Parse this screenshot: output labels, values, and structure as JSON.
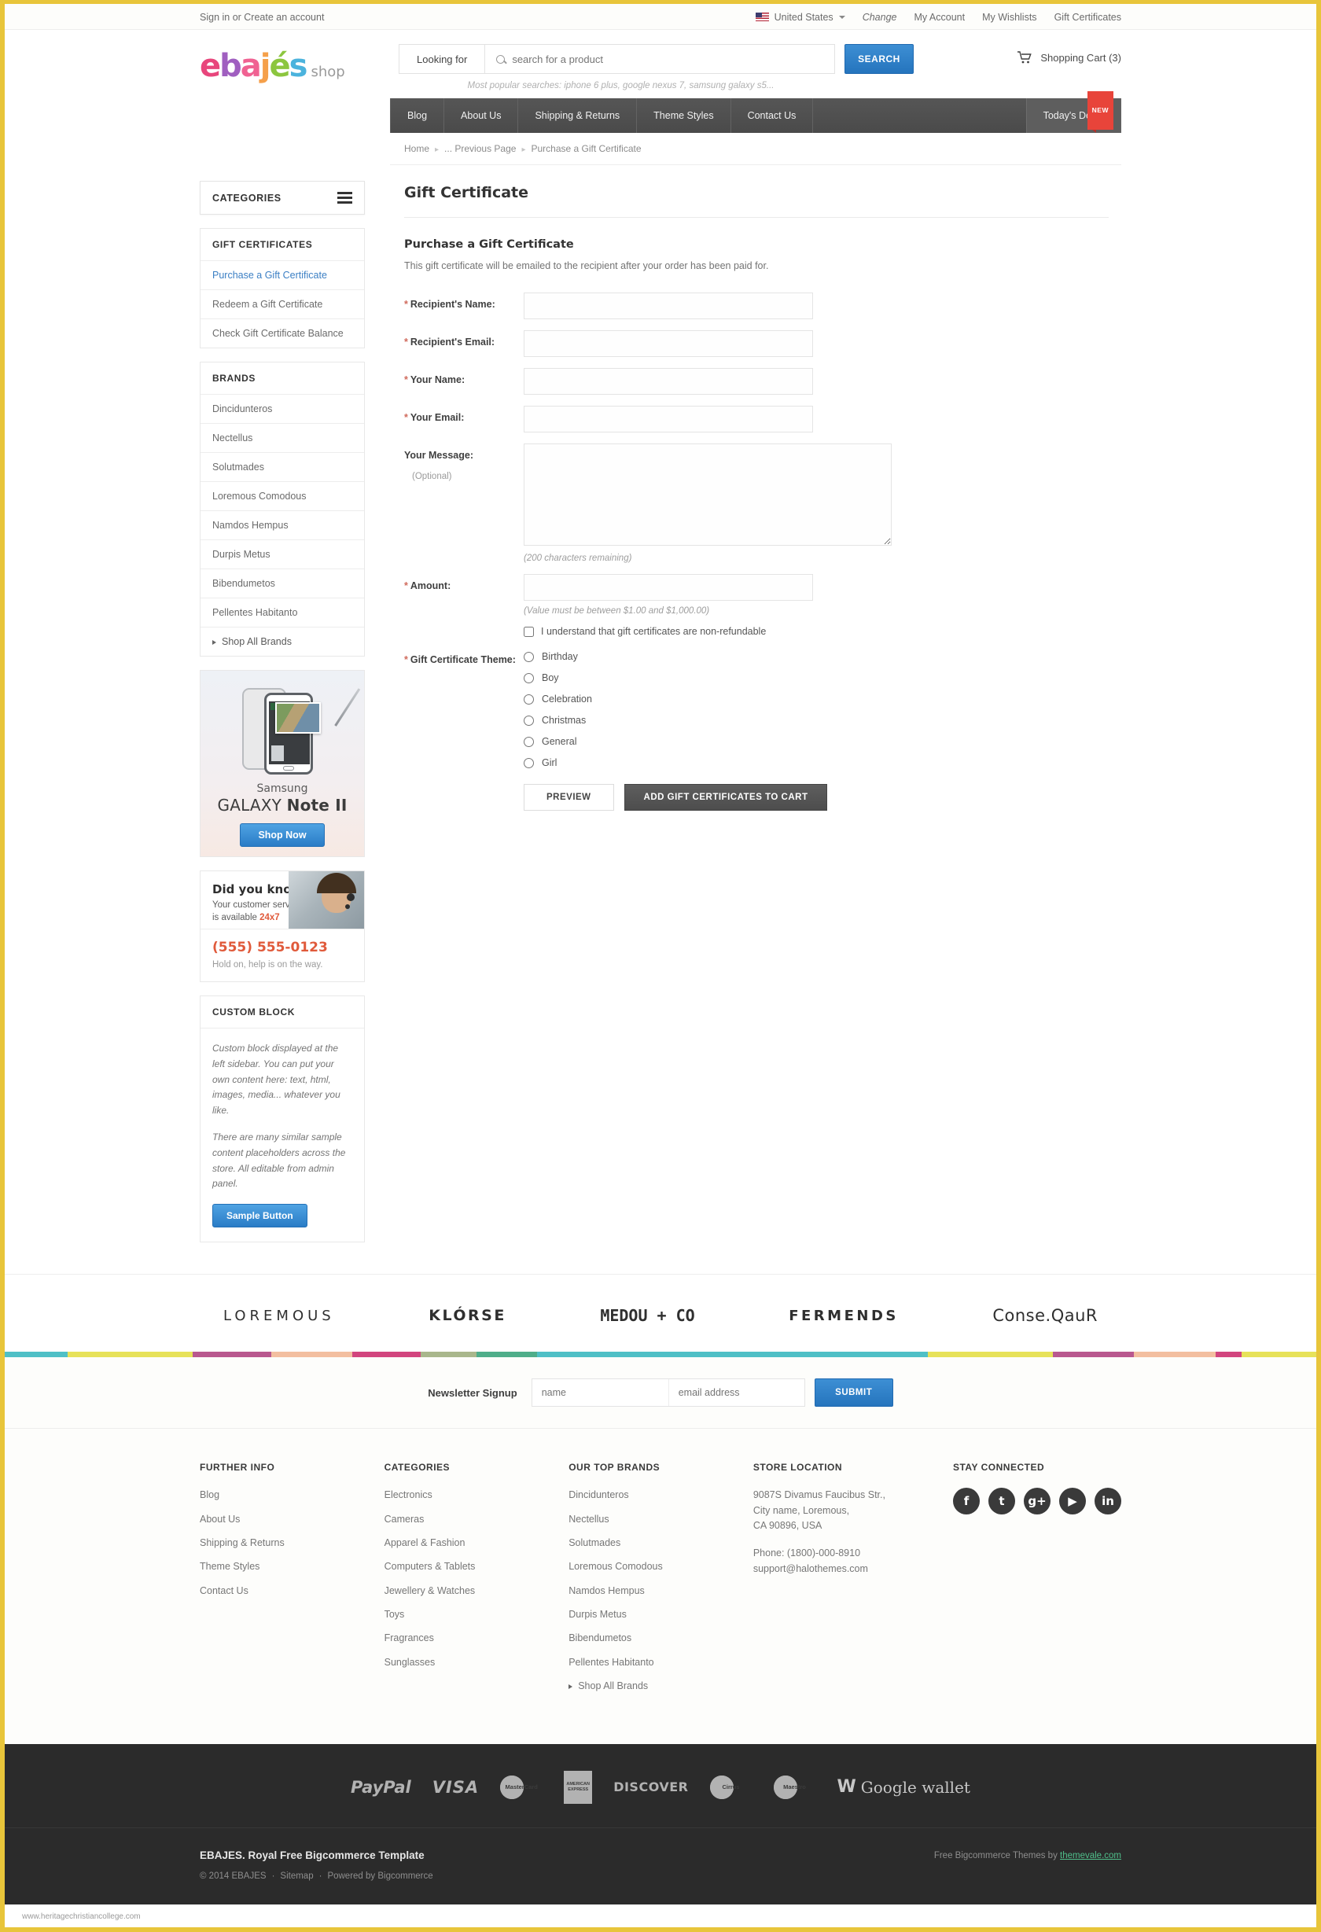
{
  "topbar": {
    "signin": "Sign in or Create an account",
    "country": "United States",
    "change": "Change",
    "my_account": "My Account",
    "my_wishlists": "My Wishlists",
    "gift_certificates": "Gift Certificates"
  },
  "header": {
    "logo_letters": [
      "e",
      "b",
      "a",
      "j",
      "és"
    ],
    "logo_word": "ebajés",
    "logo_shop": "shop",
    "looking_for": "Looking for",
    "search_placeholder": "search for a product",
    "search_value": "",
    "search_button": "SEARCH",
    "popular": "Most popular searches: iphone 6 plus, google nexus 7, samsung galaxy s5...",
    "cart": "Shopping Cart (3)"
  },
  "nav": {
    "items": [
      "Blog",
      "About Us",
      "Shipping & Returns",
      "Theme Styles",
      "Contact Us"
    ],
    "deals": "Today's Deals",
    "deals_badge": "NEW"
  },
  "breadcrumb": [
    "Home",
    "... Previous Page",
    "Purchase a Gift Certificate"
  ],
  "sidebar": {
    "categories_title": "CATEGORIES",
    "gift_block": {
      "title": "GIFT CERTIFICATES",
      "items": [
        {
          "label": "Purchase a Gift Certificate",
          "active": true
        },
        {
          "label": "Redeem a Gift Certificate",
          "active": false
        },
        {
          "label": "Check Gift Certificate Balance",
          "active": false
        }
      ]
    },
    "brands_block": {
      "title": "BRANDS",
      "items": [
        "Dincidunteros",
        "Nectellus",
        "Solutmades",
        "Loremous Comodous",
        "Namdos Hempus",
        "Durpis Metus",
        "Bibendumetos",
        "Pellentes Habitanto"
      ],
      "all": "Shop All Brands"
    },
    "banner": {
      "brand": "Samsung",
      "model_light": "GALAXY ",
      "model_bold": "Note II",
      "button": "Shop Now"
    },
    "didyouknow": {
      "title": "Did you know?",
      "line1": "Your customer service",
      "line2_pre": "is available ",
      "line2_hl": "24x7",
      "phone": "(555) 555-0123",
      "note": "Hold on, help is on the way."
    },
    "custom_block": {
      "title": "CUSTOM BLOCK",
      "p1": "Custom block displayed at the left sidebar. You can put your own content here: text, html, images, media... whatever you like.",
      "p2": "There are many similar sample content placeholders across the store. All editable from admin panel.",
      "button": "Sample Button"
    }
  },
  "main": {
    "page_title": "Gift Certificate",
    "section_title": "Purchase a Gift Certificate",
    "lead": "This gift certificate will be emailed to the recipient after your order has been paid for.",
    "fields": [
      {
        "label": "Recipient's Name:",
        "required": true,
        "value": ""
      },
      {
        "label": "Recipient's Email:",
        "required": true,
        "value": ""
      },
      {
        "label": "Your Name:",
        "required": true,
        "value": ""
      },
      {
        "label": "Your Email:",
        "required": true,
        "value": ""
      }
    ],
    "message_label": "Your Message:",
    "message_optional": "(Optional)",
    "message_value": "",
    "message_hint": "(200 characters remaining)",
    "amount_label": "Amount:",
    "amount_value": "",
    "amount_hint": "(Value must be between $1.00 and $1,000.00)",
    "nonrefundable": "I understand that gift certificates are non-refundable",
    "theme_label": "Gift Certificate Theme:",
    "themes": [
      "Birthday",
      "Boy",
      "Celebration",
      "Christmas",
      "General",
      "Girl"
    ],
    "preview_button": "PREVIEW",
    "addcart_button": "ADD GIFT CERTIFICATES TO CART"
  },
  "brandstrip": [
    "LOREMOUS",
    "KLÓRSE",
    "MEDOU + CO",
    "FERMENDS",
    "Conse.QauR"
  ],
  "colorbar": [
    {
      "color": "#4fc0c6",
      "w": 4.8
    },
    {
      "color": "#e7e25a",
      "w": 9.5
    },
    {
      "color": "#b9588f",
      "w": 6.0
    },
    {
      "color": "#f3bfa0",
      "w": 6.2
    },
    {
      "color": "#d2457e",
      "w": 5.2
    },
    {
      "color": "#a9b78c",
      "w": 4.3
    },
    {
      "color": "#4fae8a",
      "w": 4.6
    },
    {
      "color": "#4fc0c6",
      "w": 29.8
    },
    {
      "color": "#e7e25a",
      "w": 9.5
    },
    {
      "color": "#b9588f",
      "w": 6.2
    },
    {
      "color": "#f3bfa0",
      "w": 6.2
    },
    {
      "color": "#d2457e",
      "w": 2.0
    },
    {
      "color": "#e7e25a",
      "w": 5.7
    }
  ],
  "newsletter": {
    "label": "Newsletter Signup",
    "name_placeholder": "name",
    "name_value": "",
    "email_placeholder": "email address",
    "email_value": "",
    "submit": "SUBMIT"
  },
  "footer": {
    "further_info": {
      "head": "FURTHER INFO",
      "items": [
        "Blog",
        "About Us",
        "Shipping & Returns",
        "Theme Styles",
        "Contact Us"
      ]
    },
    "categories": {
      "head": "CATEGORIES",
      "items": [
        "Electronics",
        "Cameras",
        "Apparel & Fashion",
        "Computers & Tablets",
        "Jewellery & Watches",
        "Toys",
        "Fragrances",
        "Sunglasses"
      ]
    },
    "top_brands": {
      "head": "OUR TOP BRANDS",
      "items": [
        "Dincidunteros",
        "Nectellus",
        "Solutmades",
        "Loremous Comodous",
        "Namdos Hempus",
        "Durpis Metus",
        "Bibendumetos",
        "Pellentes Habitanto"
      ],
      "all": "Shop All Brands"
    },
    "store": {
      "head": "STORE LOCATION",
      "addr1": "9087S Divamus Faucibus Str.,",
      "addr2": "City name, Loremous,",
      "addr3": "CA 90896, USA",
      "phone": "Phone: (1800)-000-8910",
      "email": "support@halothemes.com"
    },
    "social": {
      "head": "STAY CONNECTED",
      "icons": [
        "facebook-icon",
        "twitter-icon",
        "google-plus-icon",
        "youtube-icon",
        "linkedin-icon"
      ],
      "glyphs": [
        "f",
        "t",
        "g+",
        "▶",
        "in"
      ]
    }
  },
  "payments": [
    "PayPal",
    "VISA",
    "MasterCard",
    "AMERICAN EXPRESS",
    "DISCOVER",
    "Cirrus",
    "Maestro",
    "Google wallet"
  ],
  "bottom": {
    "title": "EBAJES. Royal Free Bigcommerce Template",
    "copyright": "© 2014 EBAJES",
    "sitemap": "Sitemap",
    "powered": "Powered by Bigcommerce",
    "credit_pre": "Free Bigcommerce Themes by ",
    "credit_link": "themevale.com"
  },
  "watermark": "www.heritagechristiancollege.com"
}
